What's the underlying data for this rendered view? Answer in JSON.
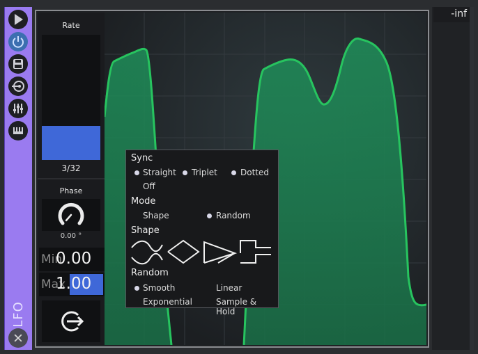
{
  "sidebar": {
    "buttons": [
      {
        "name": "play-icon"
      },
      {
        "name": "power-icon"
      },
      {
        "name": "save-icon"
      },
      {
        "name": "route-icon"
      },
      {
        "name": "sliders-icon"
      },
      {
        "name": "keyboard-icon"
      }
    ],
    "title": "LFO",
    "close_icon": "close-icon"
  },
  "controls": {
    "rate": {
      "label": "Rate",
      "value": "3/32",
      "fill_fraction": 0.27
    },
    "phase": {
      "label": "Phase",
      "value": "0.00 °"
    },
    "min": {
      "label": "Min",
      "value": "0.00"
    },
    "max": {
      "label": "Max",
      "value": "1.00"
    },
    "retrigger_icon": "retrigger-icon"
  },
  "meter": {
    "value": "-inf"
  },
  "popup": {
    "sync": {
      "title": "Sync",
      "options": [
        "Straight",
        "Triplet",
        "Dotted",
        "Off"
      ]
    },
    "mode": {
      "title": "Mode",
      "options": [
        "Shape",
        "Random"
      ]
    },
    "shape": {
      "title": "Shape",
      "icons": [
        "sine-shape-icon",
        "triangle-shape-icon",
        "saw-shape-icon",
        "square-shape-icon"
      ]
    },
    "random": {
      "title": "Random",
      "options": [
        "Smooth",
        "Linear",
        "Exponential",
        "Sample & Hold"
      ]
    }
  },
  "colors": {
    "accent_purple": "#9a7bf0",
    "accent_blue": "#3f68d8",
    "curve_green": "#22c55e",
    "fill_green": "#1f7a4f"
  }
}
